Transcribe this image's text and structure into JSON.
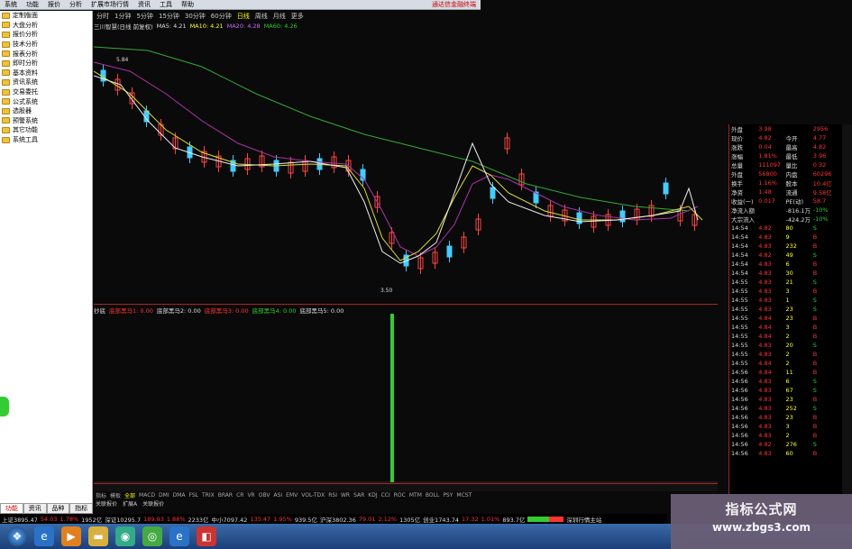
{
  "menu": {
    "items": [
      "系统",
      "功能",
      "报价",
      "分析",
      "扩展市场行情",
      "资讯",
      "工具",
      "帮助"
    ],
    "right_label": "通达信金融终端"
  },
  "sidebar": {
    "items": [
      "定制版面",
      "大盘分析",
      "报价分析",
      "技术分析",
      "报表分析",
      "即时分析",
      "基本资料",
      "资讯系统",
      "交易委托",
      "公式系统",
      "选股器",
      "预警系统",
      "其它功能",
      "系统工具"
    ],
    "tabs": [
      "功能",
      "资讯",
      "品种",
      "指标"
    ]
  },
  "periodbar": {
    "items": [
      "分时",
      "1分钟",
      "5分钟",
      "15分钟",
      "30分钟",
      "60分钟",
      "日线",
      "周线",
      "月线",
      "更多"
    ],
    "active": "日线"
  },
  "ma_legend": {
    "title": "三川智慧(日线 前复权)",
    "ma5": "MA5: 4.21",
    "ma10": "MA10: 4.21",
    "ma20": "MA20: 4.28",
    "ma60": "MA60: 4.26"
  },
  "ind_legend": {
    "title": "抄底",
    "l1": "底部黑马1: 0.00",
    "l2": "底部黑马2: 0.00",
    "l3": "底部黑马3: 0.00",
    "l4": "底部黑马4: 0.00",
    "l5": "底部黑马5: 0.00"
  },
  "chart_labels": {
    "high": "5.84",
    "low": "3.50"
  },
  "indicator_tabs": {
    "items": [
      "指标",
      "模板",
      "全部",
      "MACD",
      "DMI",
      "DMA",
      "FSL",
      "TRIX",
      "BRAR",
      "CR",
      "VR",
      "OBV",
      "ASI",
      "EMV",
      "VOL-TDX",
      "RSI",
      "WR",
      "SAR",
      "KDJ",
      "CCI",
      "ROC",
      "MTM",
      "BOLL",
      "PSY",
      "MCST"
    ],
    "active": "全部"
  },
  "sub_tabs": {
    "items": [
      "关联报价",
      "扩展A",
      "关联报价"
    ]
  },
  "quote": {
    "top": [
      [
        "外盘",
        "3.98",
        "",
        "2956"
      ],
      [
        "现价",
        "4.82",
        "今开",
        "4.77"
      ],
      [
        "涨跌",
        "0.04",
        "最高",
        "4.82"
      ],
      [
        "涨幅",
        "1.81%",
        "最低",
        "3.96"
      ],
      [
        "总量",
        "111097",
        "量比",
        "0.32"
      ],
      [
        "外盘",
        "56800",
        "内盘",
        "60296"
      ],
      [
        "换手",
        "1.16%",
        "股本",
        "10.4亿"
      ],
      [
        "净资",
        "1.48",
        "流通",
        "9.58亿"
      ],
      [
        "收益(一)",
        "0.017",
        "PE(动)",
        "58.7"
      ],
      [
        "净流入额",
        "",
        "-816.1万",
        "-10%"
      ],
      [
        "大宗流入",
        "",
        "-424.2万",
        "-10%"
      ]
    ],
    "ticks": [
      [
        "14:54",
        "4.82",
        "80",
        "S"
      ],
      [
        "14:54",
        "4.83",
        "9",
        "B"
      ],
      [
        "14:54",
        "4.83",
        "232",
        "B"
      ],
      [
        "14:54",
        "4.82",
        "49",
        "S"
      ],
      [
        "14:54",
        "4.83",
        "6",
        "B"
      ],
      [
        "14:54",
        "4.83",
        "30",
        "B"
      ],
      [
        "14:55",
        "4.83",
        "21",
        "S"
      ],
      [
        "14:55",
        "4.83",
        "3",
        "B"
      ],
      [
        "14:55",
        "4.83",
        "1",
        "S"
      ],
      [
        "14:55",
        "4.83",
        "23",
        "S"
      ],
      [
        "14:55",
        "4.84",
        "23",
        "B"
      ],
      [
        "14:55",
        "4.84",
        "3",
        "B"
      ],
      [
        "14:55",
        "4.84",
        "2",
        "B"
      ],
      [
        "14:55",
        "4.83",
        "20",
        "S"
      ],
      [
        "14:55",
        "4.83",
        "2",
        "B"
      ],
      [
        "14:55",
        "4.84",
        "2",
        "B"
      ],
      [
        "14:56",
        "4.84",
        "11",
        "B"
      ],
      [
        "14:56",
        "4.83",
        "6",
        "S"
      ],
      [
        "14:56",
        "4.83",
        "67",
        "S"
      ],
      [
        "14:56",
        "4.83",
        "23",
        "B"
      ],
      [
        "14:56",
        "4.83",
        "252",
        "S"
      ],
      [
        "14:56",
        "4.83",
        "23",
        "B"
      ],
      [
        "14:56",
        "4.83",
        "3",
        "B"
      ],
      [
        "14:56",
        "4.83",
        "2",
        "B"
      ],
      [
        "14:56",
        "4.82",
        "276",
        "S"
      ],
      [
        "14:56",
        "4.83",
        "60",
        "B"
      ]
    ]
  },
  "status": {
    "sh": "上证3895.47",
    "sh_chg": "54.03",
    "sh_pct": "1.78%",
    "sh_amt": "1952亿",
    "sz": "深证10295.7",
    "sz_chg": "189.93",
    "sz_pct": "1.88%",
    "sz_amt": "2233亿",
    "zx": "中小7097.42",
    "zx_chg": "135.47",
    "zx_pct": "1.95%",
    "zx_amt": "939.5亿",
    "hs": "沪深3802.36",
    "hs_chg": "79.01",
    "hs_pct": "2.12%",
    "hs_amt": "1305亿",
    "cy": "创业1743.74",
    "cy_chg": "17.32",
    "cy_pct": "1.01%",
    "cy_amt": "893.7亿",
    "right": "深圳行情主站"
  },
  "watermark": {
    "title": "指标公式网",
    "url": "www.zbgs3.com"
  }
}
